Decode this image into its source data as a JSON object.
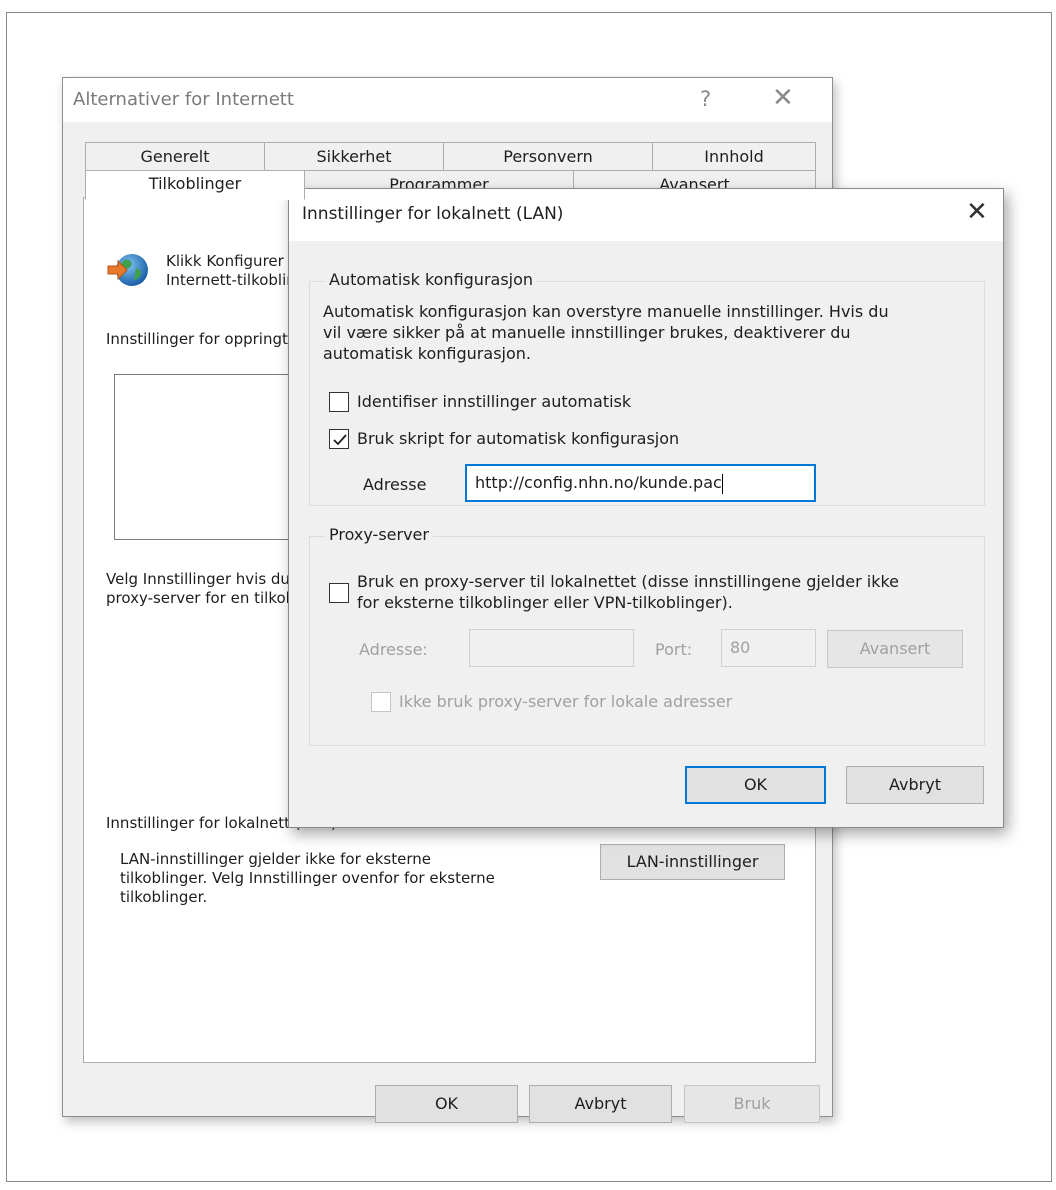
{
  "internet_options": {
    "title": "Alternativer for Internett",
    "help_label": "?",
    "close_label": "✕",
    "tabs_row1": [
      "Generelt",
      "Sikkerhet",
      "Personvern",
      "Innhold"
    ],
    "tabs_row2": [
      "Tilkoblinger",
      "Programmer",
      "Avansert"
    ],
    "active_tab": "Tilkoblinger",
    "setup_text_1": "Klikk Konfigurer for å konfigurere en",
    "setup_text_2": "Internett-tilkobling.",
    "dialup_heading": "Innstillinger for oppringte og virtuelle private nettverk",
    "proxy_text_1": "Velg Innstillinger hvis du må konfigurere en",
    "proxy_text_2": "proxy-server for en tilkobling.",
    "lan_heading": "Innstillinger for lokalnett (LAN)",
    "lan_text_1": "LAN-innstillinger gjelder ikke for eksterne",
    "lan_text_2": "tilkoblinger. Velg Innstillinger ovenfor for eksterne",
    "lan_text_3": "tilkoblinger.",
    "lan_settings_button": "LAN-innstillinger",
    "ok_button": "OK",
    "cancel_button": "Avbryt",
    "apply_button": "Bruk"
  },
  "lan_dialog": {
    "title": "Innstillinger for lokalnett (LAN)",
    "close_label": "✕",
    "auto_group_title": "Automatisk konfigurasjon",
    "auto_description_1": "Automatisk konfigurasjon kan overstyre manuelle innstillinger. Hvis du",
    "auto_description_2": "vil være sikker på at manuelle innstillinger brukes, deaktiverer du",
    "auto_description_3": "automatisk konfigurasjon.",
    "auto_detect_label": "Identifiser innstillinger automatisk",
    "auto_detect_checked": false,
    "use_script_label": "Bruk skript for automatisk konfigurasjon",
    "use_script_checked": true,
    "script_address_label": "Adresse",
    "script_address_value": "http://config.nhn.no/kunde.pac",
    "proxy_group_title": "Proxy-server",
    "use_proxy_label_1": "Bruk en proxy-server til lokalnettet (disse innstillingene gjelder ikke",
    "use_proxy_label_2": "for eksterne tilkoblinger eller VPN-tilkoblinger).",
    "use_proxy_checked": false,
    "proxy_address_label": "Adresse:",
    "proxy_address_value": "",
    "port_label": "Port:",
    "port_value": "80",
    "advanced_button": "Avansert",
    "bypass_local_label": "Ikke bruk proxy-server for lokale adresser",
    "bypass_local_checked": false,
    "ok_button": "OK",
    "cancel_button": "Avbryt"
  },
  "colors": {
    "accent": "#0078d7",
    "dialog_background": "#f0f0f0",
    "disabled_text": "#a0a0a0"
  },
  "icons": {
    "globe": "globe-network-icon",
    "checkmark": "checkmark-icon",
    "close": "close-icon"
  }
}
